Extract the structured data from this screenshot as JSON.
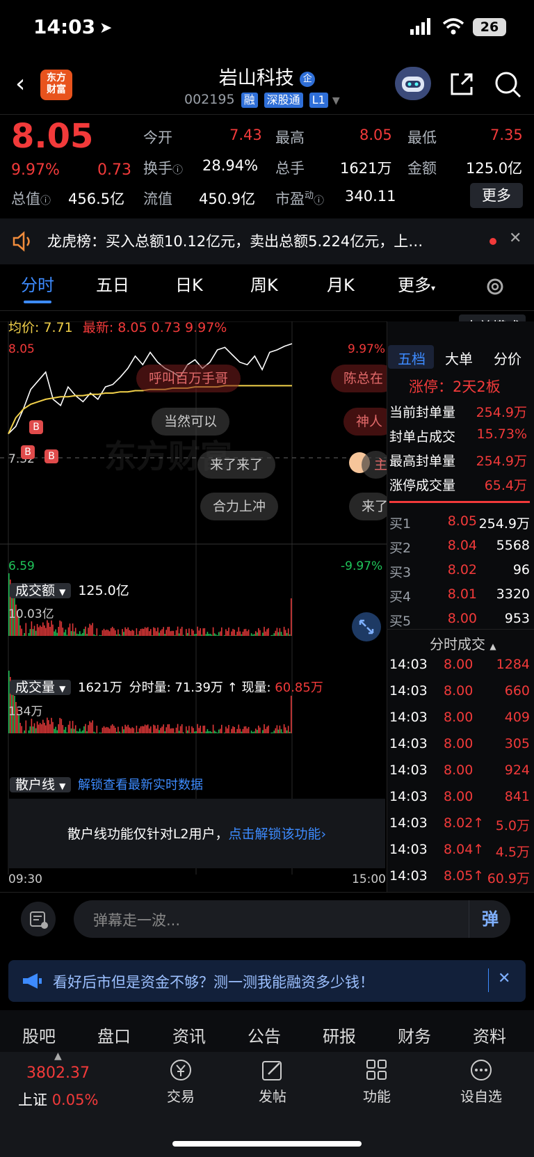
{
  "status": {
    "time": "14:03",
    "battery": "26"
  },
  "header": {
    "logo": [
      "东方",
      "财富"
    ],
    "title": "岩山科技",
    "title_badge": "企",
    "code": "002195",
    "tags": [
      "融",
      "深股通",
      "L1"
    ]
  },
  "quote": {
    "price": "8.05",
    "change_pct": "9.97%",
    "change": "0.73",
    "open_label": "今开",
    "open": "7.43",
    "high_label": "最高",
    "high": "8.05",
    "low_label": "最低",
    "low": "7.35",
    "turnover_label": "换手",
    "turnover": "28.94%",
    "volume_label": "总手",
    "volume": "1621万",
    "amount_label": "金额",
    "amount": "125.0亿",
    "mktcap_label": "总值",
    "mktcap": "456.5亿",
    "float_label": "流值",
    "float": "450.9亿",
    "pe_label": "市盈",
    "pe_sup": "动",
    "pe": "340.11",
    "more": "更多"
  },
  "banner": {
    "text": "龙虎榜：买入总额10.12亿元，卖出总额5.224亿元，上…"
  },
  "tabs": [
    "分时",
    "五日",
    "日K",
    "周K",
    "月K",
    "更多"
  ],
  "intraday": {
    "avg_label": "均价:",
    "avg": "7.71",
    "latest_label": "最新:",
    "latest": "8.05",
    "latest_chg": "0.73",
    "latest_pct": "9.97%",
    "big_order_mode": "大单模式",
    "axis_top": "8.05",
    "axis_mid": "7.32",
    "axis_bottom": "6.59",
    "pct_top": "9.97%",
    "pct_bottom": "-9.97%",
    "time_start": "09:30",
    "time_end": "15:00",
    "watermark": "东方财富",
    "danmu": [
      "呼叫百万手哥",
      "陈总在",
      "当然可以",
      "神人",
      "来了来了",
      "主",
      "合力上冲",
      "来了"
    ],
    "markers": [
      "B",
      "B",
      "B"
    ]
  },
  "chart_data": {
    "type": "line",
    "title": "",
    "ylim": [
      6.59,
      8.05
    ],
    "x": [
      "09:30",
      "15:00"
    ],
    "series": [
      {
        "values": [
          7.32,
          7.38,
          7.52,
          7.68,
          7.75,
          7.82,
          7.6,
          7.55,
          7.7,
          7.63,
          7.58,
          7.65,
          7.6,
          7.7,
          7.72,
          7.78,
          7.85,
          7.95,
          7.88,
          7.98,
          7.9,
          7.85,
          7.82,
          7.78,
          7.88,
          7.92,
          7.85,
          7.9,
          8.0,
          8.02,
          7.96,
          7.9,
          7.88,
          7.95,
          7.84,
          7.98,
          8.0,
          8.03,
          8.05
        ]
      },
      {
        "values": [
          7.32,
          7.45,
          7.52,
          7.56,
          7.58,
          7.6,
          7.61,
          7.62,
          7.62,
          7.63,
          7.63,
          7.64,
          7.64,
          7.65,
          7.65,
          7.66,
          7.66,
          7.67,
          7.67,
          7.68,
          7.68,
          7.68,
          7.69,
          7.69,
          7.69,
          7.7,
          7.7,
          7.7,
          7.7,
          7.71,
          7.71,
          7.71,
          7.71,
          7.71,
          7.71,
          7.71,
          7.71,
          7.71,
          7.71
        ]
      }
    ]
  },
  "amount_panel": {
    "label": "成交额",
    "total": "125.0亿",
    "axis_top": "10.03亿"
  },
  "volume_panel": {
    "label": "成交量",
    "total": "1621万",
    "period_label": "分时量:",
    "period": "71.39万",
    "now_label": "现量:",
    "now": "60.85万",
    "axis_top": "134万"
  },
  "retail_panel": {
    "label": "散户线",
    "unlock_link": "解锁查看最新实时数据",
    "notice": "散户线功能仅针对L2用户，",
    "notice_link": "点击解锁该功能"
  },
  "right_panel": {
    "tabs": [
      "五档",
      "大单",
      "分价"
    ],
    "limit_title": "涨停：2天2板",
    "stats": [
      {
        "label": "当前封单量",
        "value": "254.9万"
      },
      {
        "label": "封单占成交",
        "value": "15.73%"
      },
      {
        "label": "最高封单量",
        "value": "254.9万"
      },
      {
        "label": "涨停成交量",
        "value": "65.4万"
      }
    ],
    "bids": [
      {
        "label": "买1",
        "price": "8.05",
        "vol": "254.9万"
      },
      {
        "label": "买2",
        "price": "8.04",
        "vol": "5568"
      },
      {
        "label": "买3",
        "price": "8.02",
        "vol": "96"
      },
      {
        "label": "买4",
        "price": "8.01",
        "vol": "3320"
      },
      {
        "label": "买5",
        "price": "8.00",
        "vol": "953"
      }
    ],
    "ticks_title": "分时成交",
    "ticks": [
      {
        "time": "14:03",
        "price": "8.00",
        "vol": "1284"
      },
      {
        "time": "14:03",
        "price": "8.00",
        "vol": "660"
      },
      {
        "time": "14:03",
        "price": "8.00",
        "vol": "409"
      },
      {
        "time": "14:03",
        "price": "8.00",
        "vol": "305"
      },
      {
        "time": "14:03",
        "price": "8.00",
        "vol": "924"
      },
      {
        "time": "14:03",
        "price": "8.00",
        "vol": "841"
      },
      {
        "time": "14:03",
        "price": "8.02↑",
        "vol": "5.0万"
      },
      {
        "time": "14:03",
        "price": "8.04↑",
        "vol": "4.5万"
      },
      {
        "time": "14:03",
        "price": "8.05↑",
        "vol": "60.9万"
      }
    ]
  },
  "danmu_input": {
    "placeholder": "弹幕走一波...",
    "send": "弹"
  },
  "ad": {
    "text": "看好后市但是资金不够？测一测我能融资多少钱！"
  },
  "bottom_tabs": [
    "股吧",
    "盘口",
    "资讯",
    "公告",
    "研报",
    "财务",
    "资料"
  ],
  "bottom_nav": {
    "index_value": "3802.37",
    "index_name": "上证",
    "index_pct": "0.05%",
    "items": [
      "交易",
      "发帖",
      "功能",
      "设自选"
    ]
  },
  "colors": {
    "up": "#f23a3a",
    "down": "#1fc55a",
    "avg_line": "#f2d14a",
    "accent": "#3d8bff"
  }
}
